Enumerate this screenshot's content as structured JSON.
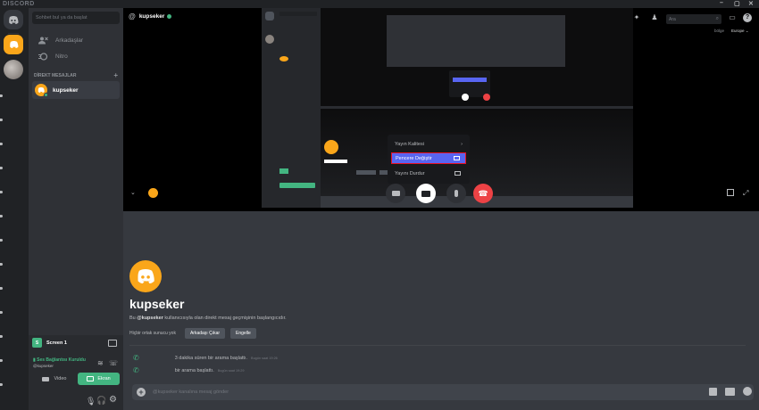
{
  "app": {
    "brand": "DISCORD",
    "window_controls": [
      "–",
      "▢",
      "✕"
    ]
  },
  "sidebar": {
    "search_placeholder": "Sohbet bul ya da başlat",
    "nav": [
      {
        "label": "Arkadaşlar",
        "icon": "friends-icon"
      },
      {
        "label": "Nitro",
        "icon": "nitro-icon"
      }
    ],
    "dm_header": "DİREKT MESAJLAR",
    "dm_add": "+",
    "dms": [
      {
        "name": "kupseker",
        "status": "online"
      }
    ]
  },
  "screen_panel": {
    "title": "Screen 1",
    "voice_status": "Ses Bağlantısı Kuruldu",
    "voice_sub": "@kupseker",
    "video_label": "Video",
    "screen_label": "Ekran"
  },
  "header": {
    "title": "kupseker",
    "search_placeholder": "Ara",
    "region_label": "bölge",
    "region_value": "Europe"
  },
  "stream_menu": {
    "items": [
      "Yayın Kalitesi",
      "Pencere Değiştir",
      "Yayını Durdur"
    ],
    "selected_index": 1
  },
  "chat": {
    "name": "kupseker",
    "desc_pre": "Bu ",
    "desc_user": "@kupseker",
    "desc_post": " kullanıcısıyla olan direkt mesaj geçmişinin başlangıcıdır.",
    "no_mutual": "Hiçbir ortak sunucu yok",
    "remove_friend": "Arkadaşı Çıkar",
    "block": "Engelle",
    "messages": [
      {
        "text": "3 dakika süren bir arama başlattı.",
        "time": "Bugün saat 19:26"
      },
      {
        "text": "bir arama başlattı.",
        "time": "Bugün saat 19:29"
      }
    ],
    "composer_placeholder": "@kupseker kanalına mesaj gönder"
  },
  "colors": {
    "accent": "#5865f2",
    "green": "#43b581",
    "danger": "#ed4245",
    "orange": "#faa61a"
  }
}
